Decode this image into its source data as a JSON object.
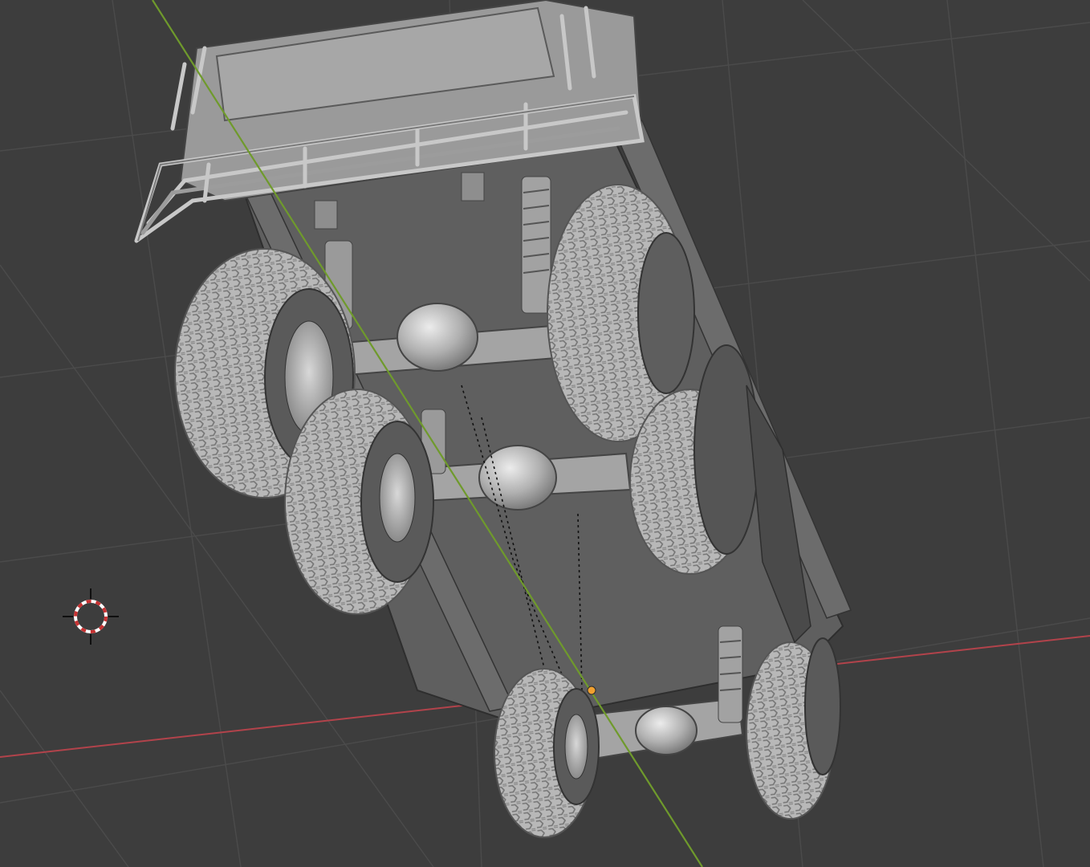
{
  "viewport": {
    "name": "3D Viewport",
    "shading": "solid",
    "background": "#3d3d3d",
    "grid_color": "#4a4a4a",
    "x_axis_color": "#b2434b",
    "y_axis_color": "#6f9a2c",
    "origin_color": "#f0a030",
    "model_color": "#a8a8a8",
    "model_shadow": "#6e6e6e",
    "model_highlight": "#d6d6d6",
    "cursor_colors": [
      "#c83232",
      "#ffffff",
      "#000000"
    ]
  },
  "scene": {
    "object": "6x6-truck-chassis",
    "wheels": 6,
    "axles": 3,
    "view": "underside"
  }
}
